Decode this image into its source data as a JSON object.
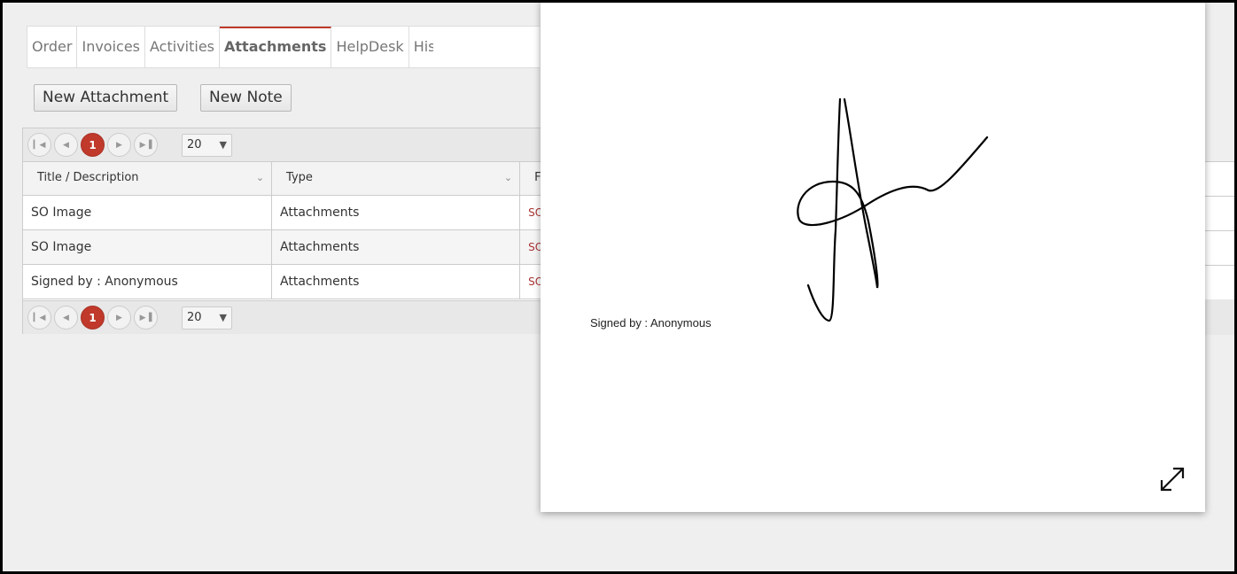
{
  "tabs": [
    "Order",
    "Invoices",
    "Activities",
    "Attachments",
    "HelpDesk",
    "History"
  ],
  "active_tab": "Attachments",
  "buttons": {
    "new_attachment": "New Attachment",
    "new_note": "New Note"
  },
  "pager": {
    "current_page": "1",
    "page_size": "20"
  },
  "grid": {
    "columns": [
      "Title / Description",
      "Type",
      "F"
    ],
    "rows": [
      {
        "title": "SO Image",
        "type": "Attachments",
        "file": "SO"
      },
      {
        "title": "SO Image",
        "type": "Attachments",
        "file": "SO"
      },
      {
        "title": "Signed by : Anonymous",
        "type": "Attachments",
        "file": "SO"
      }
    ]
  },
  "preview": {
    "caption": "Signed by : Anonymous",
    "expand_icon": "expand-icon"
  }
}
